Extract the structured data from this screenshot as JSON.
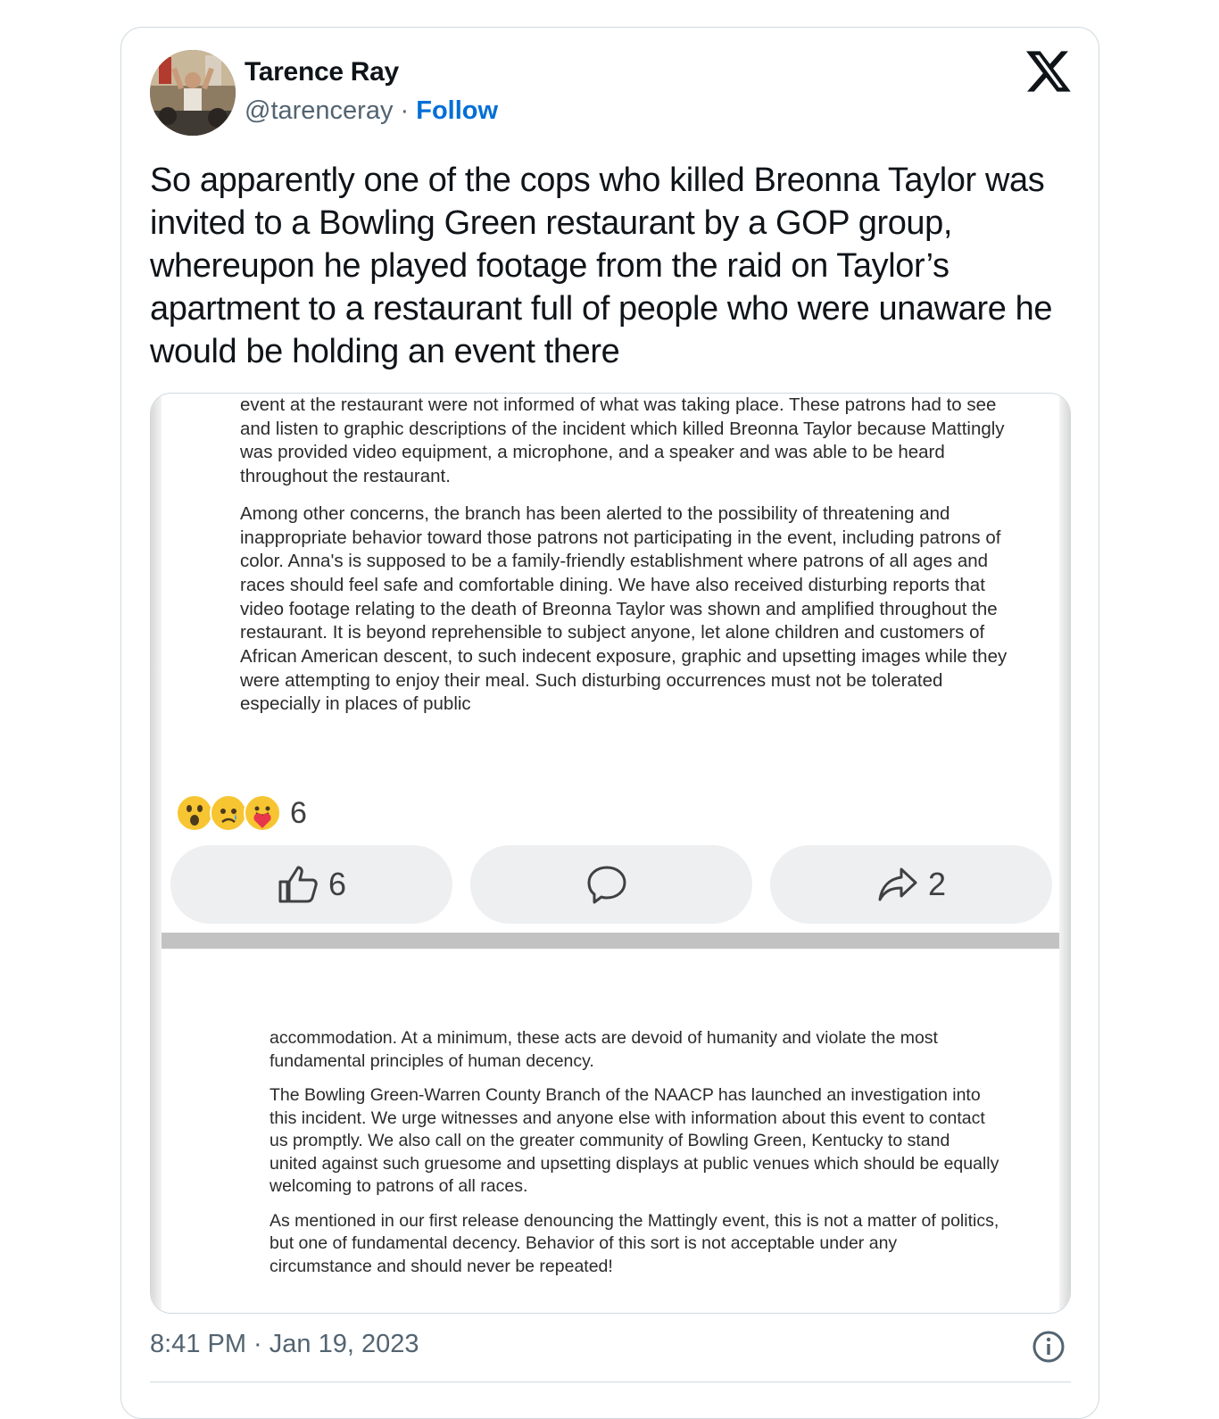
{
  "author": {
    "name": "Tarence Ray",
    "handle": "@tarenceray",
    "separator": " · ",
    "follow_label": "Follow",
    "avatar_icon": "profile-photo"
  },
  "brand": {
    "logo": "x-logo-icon"
  },
  "tweet": {
    "text": "So apparently one of the cops who killed Breonna Taylor was invited to a Bowling Green restaurant by a GOP group, whereupon he played footage from the raid on Taylor’s apartment to a restaurant full of people who were unaware he would be holding an event there"
  },
  "media": {
    "doc_top": {
      "paragraphs": [
        "event at the restaurant were not informed of what was taking place. These patrons had to see and listen to graphic descriptions of the incident which killed Breonna Taylor because Mattingly was provided video equipment, a microphone, and a speaker and was able to be heard throughout the restaurant.",
        "Among other concerns, the branch has been alerted to the possibility of threatening and inappropriate behavior toward those patrons not participating in the event, including patrons of color. Anna's is supposed to be a family-friendly establishment where patrons of all ages and races should feel safe and comfortable dining. We have also received disturbing reports that video footage relating to the death of Breonna Taylor was shown and amplified throughout the restaurant. It is beyond reprehensible to subject anyone, let alone children and customers of African American descent, to such indecent exposure, graphic and upsetting images while they were attempting to enjoy their meal. Such disturbing occurrences must not be tolerated especially in places of public"
      ]
    },
    "reactions": {
      "icons": [
        "wow-emoji-icon",
        "sad-emoji-icon",
        "care-emoji-icon"
      ],
      "count": "6"
    },
    "actions": {
      "like_count": "6",
      "share_count": "2"
    },
    "doc_bottom": {
      "paragraphs": [
        "accommodation.  At a minimum, these acts are devoid of humanity and violate the most fundamental principles of human decency.",
        "The Bowling Green-Warren County Branch of the NAACP has launched an investigation into this incident.  We urge witnesses and anyone else with information about this event to contact us promptly. We also call on the greater community of Bowling Green, Kentucky to stand united against such gruesome and upsetting displays at public venues which should be equally welcoming to patrons of all races.",
        "As mentioned in our first release denouncing the Mattingly event, this is not a matter of politics, but one of fundamental decency.  Behavior of this sort is not acceptable under any circumstance and should never be repeated!"
      ]
    }
  },
  "footer": {
    "timestamp": "8:41 PM · Jan 19, 2023"
  },
  "colors": {
    "follow": "#006fd6",
    "muted": "#536471",
    "border": "#cfd9de"
  }
}
